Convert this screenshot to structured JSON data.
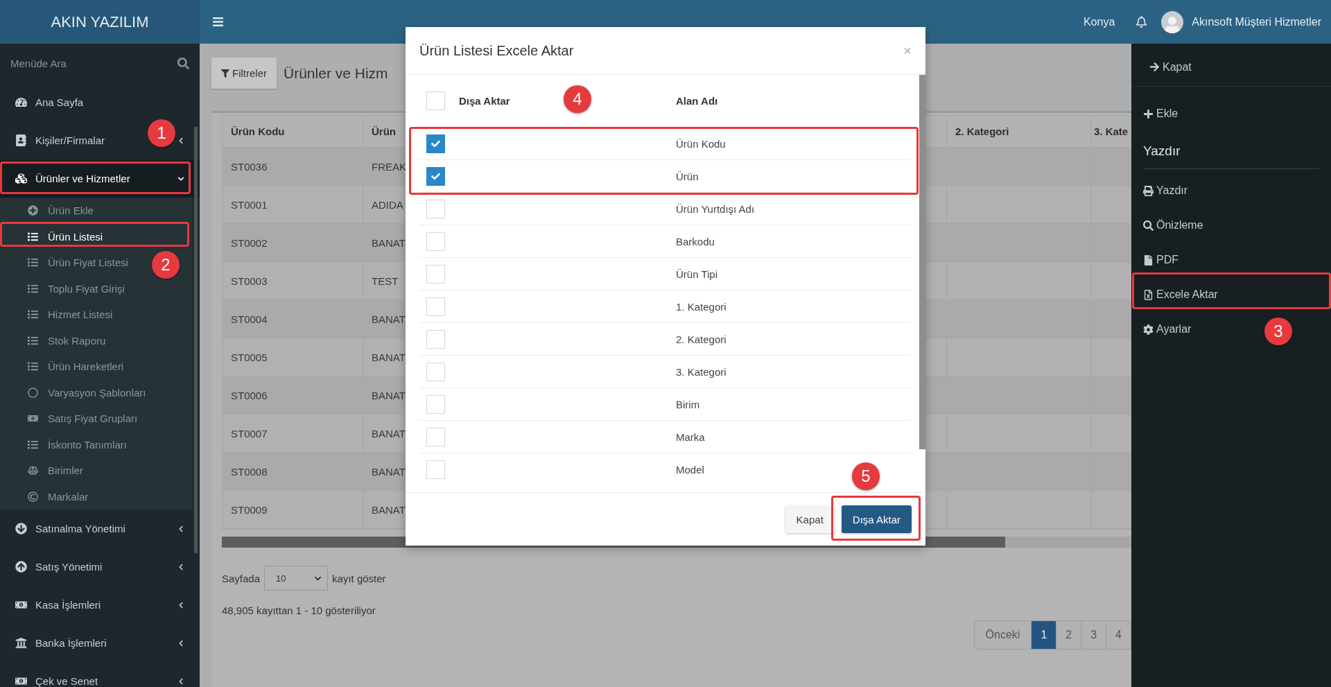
{
  "brand": "AKIN YAZILIM",
  "header": {
    "location": "Konya",
    "user": "Akınsoft Müşteri Hizmetler"
  },
  "sidebar": {
    "search_placeholder": "Menüde Ara",
    "items": [
      {
        "label": "Ana Sayfa",
        "selected": false
      },
      {
        "label": "Kişiler/Firmalar",
        "selected": false,
        "expanded": false
      },
      {
        "label": "Ürünler ve Hizmetler",
        "selected": true,
        "expanded": true,
        "children": [
          {
            "label": "Ürün Ekle",
            "selected": false
          },
          {
            "label": "Ürün Listesi",
            "selected": true
          },
          {
            "label": "Ürün Fiyat Listesi",
            "selected": false
          },
          {
            "label": "Toplu Fiyat Girişi",
            "selected": false
          },
          {
            "label": "Hizmet Listesi",
            "selected": false
          },
          {
            "label": "Stok Raporu",
            "selected": false
          },
          {
            "label": "Ürün Hareketleri",
            "selected": false
          },
          {
            "label": "Varyasyon Şablonları",
            "selected": false
          },
          {
            "label": "Satış Fiyat Grupları",
            "selected": false
          },
          {
            "label": "İskonto Tanımları",
            "selected": false
          },
          {
            "label": "Birimler",
            "selected": false
          },
          {
            "label": "Markalar",
            "selected": false
          }
        ]
      },
      {
        "label": "Satınalma Yönetimi",
        "selected": false,
        "expanded": false
      },
      {
        "label": "Satış Yönetimi",
        "selected": false,
        "expanded": false
      },
      {
        "label": "Kasa İşlemleri",
        "selected": false,
        "expanded": false
      },
      {
        "label": "Banka İşlemleri",
        "selected": false,
        "expanded": false
      },
      {
        "label": "Çek ve Senet",
        "selected": false,
        "expanded": false
      }
    ]
  },
  "page": {
    "filter_button": "Filtreler",
    "title": "Ürünler ve Hizm",
    "table": {
      "columns": [
        {
          "label": "Ürün Kodu"
        },
        {
          "label": "Ürün"
        },
        {},
        {
          "label": "2. Kategori"
        },
        {
          "label": "3. Kate"
        }
      ],
      "rows": [
        {
          "cells": [
            "ST0036",
            "FREAK"
          ]
        },
        {
          "cells": [
            "ST0001",
            "ADIDA"
          ]
        },
        {
          "cells": [
            "ST0002",
            "BANAT"
          ]
        },
        {
          "cells": [
            "ST0003",
            "TEST"
          ]
        },
        {
          "cells": [
            "ST0004",
            "BANAT"
          ]
        },
        {
          "cells": [
            "ST0005",
            "BANAT"
          ]
        },
        {
          "cells": [
            "ST0006",
            "BANAT"
          ]
        },
        {
          "cells": [
            "ST0007",
            "BANAT"
          ]
        },
        {
          "cells": [
            "ST0008",
            "BANAT"
          ]
        },
        {
          "cells": [
            "ST0009",
            "BANAT"
          ]
        }
      ]
    },
    "page_size": {
      "before": "Sayfada",
      "value": "10",
      "after": "kayıt göster"
    },
    "info": "48,905 kayıttan 1 - 10 gösteriliyor",
    "pagination": [
      {
        "label": "Önceki",
        "selected": false
      },
      {
        "label": "1",
        "selected": true
      },
      {
        "label": "2",
        "selected": false
      },
      {
        "label": "3",
        "selected": false
      },
      {
        "label": "4",
        "selected": false
      }
    ]
  },
  "right_panel": [
    {
      "kind": "link",
      "label": "Kapat"
    },
    {
      "kind": "link",
      "label": "Ekle"
    },
    {
      "kind": "heading",
      "label": "Yazdır"
    },
    {
      "kind": "link",
      "label": "Yazdır"
    },
    {
      "kind": "link",
      "label": "Önizleme"
    },
    {
      "kind": "link",
      "label": "PDF"
    },
    {
      "kind": "link",
      "label": "Excele Aktar"
    },
    {
      "kind": "link",
      "label": "Ayarlar"
    }
  ],
  "modal": {
    "title": "Ürün Listesi Excele Aktar",
    "close": "×",
    "select_all_checked": false,
    "export_column": "Dışa Aktar",
    "name_column": "Alan Adı",
    "fields": [
      {
        "name": "Ürün Kodu",
        "checked": true
      },
      {
        "name": "Ürün",
        "checked": true
      },
      {
        "name": "Ürün Yurtdışı Adı",
        "checked": false
      },
      {
        "name": "Barkodu",
        "checked": false
      },
      {
        "name": "Ürün Tipi",
        "checked": false
      },
      {
        "name": "1. Kategori",
        "checked": false
      },
      {
        "name": "2. Kategori",
        "checked": false
      },
      {
        "name": "3. Kategori",
        "checked": false
      },
      {
        "name": "Birim",
        "checked": false
      },
      {
        "name": "Marka",
        "checked": false
      },
      {
        "name": "Model",
        "checked": false
      }
    ],
    "buttons": [
      {
        "label": "Kapat",
        "kind": "default"
      },
      {
        "label": "Dışa Aktar",
        "kind": "primary"
      }
    ]
  },
  "annotations": [
    {
      "number": "1"
    },
    {
      "number": "2"
    },
    {
      "number": "3"
    },
    {
      "number": "4"
    },
    {
      "number": "5"
    }
  ]
}
